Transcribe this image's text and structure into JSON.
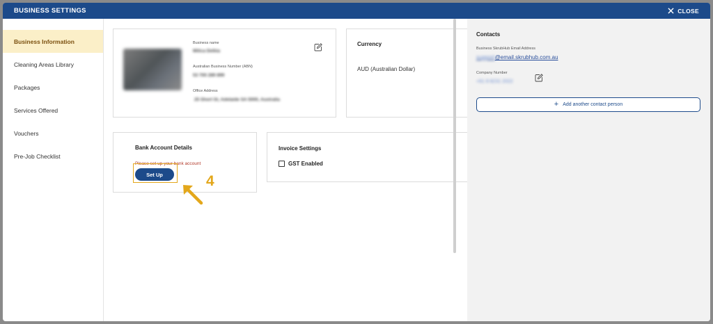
{
  "header": {
    "title": "BUSINESS SETTINGS",
    "close_label": "CLOSE"
  },
  "sidebar": {
    "items": [
      {
        "label": "Business Information",
        "active": true
      },
      {
        "label": "Cleaning Areas Library"
      },
      {
        "label": "Packages"
      },
      {
        "label": "Services Offered"
      },
      {
        "label": "Vouchers"
      },
      {
        "label": "Pre-Job Checklist"
      }
    ]
  },
  "business": {
    "name_label": "Business name",
    "name_value": "Milica Delkia",
    "abn_label": "Australian Business Number (ABN)",
    "abn_value": "53 700 289 899",
    "address_label": "Office Address",
    "address_value": "25 Short St, Adelaide SA 5000, Australia"
  },
  "currency": {
    "heading": "Currency",
    "value": "AUD (Australian Dollar)"
  },
  "bank": {
    "heading": "Bank Account Details",
    "warning": "Please set up your bank account",
    "setup_label": "Set Up",
    "step_number": "4"
  },
  "invoice": {
    "heading": "Invoice Settings",
    "gst_label": "GST Enabled",
    "gst_checked": false
  },
  "contacts": {
    "heading": "Contacts",
    "email_label": "Business SkrubHub Email Address",
    "email_blurred": "support",
    "email_domain": "@email.skrubhub.com.au",
    "phone_label": "Company Number",
    "phone_value": "+61 8 8231 2022",
    "add_label": "Add another contact person"
  },
  "colors": {
    "brand": "#1c4a8a",
    "active_bg": "#fbefc8",
    "highlight": "#e3a71b",
    "warning": "#b23a2b"
  }
}
